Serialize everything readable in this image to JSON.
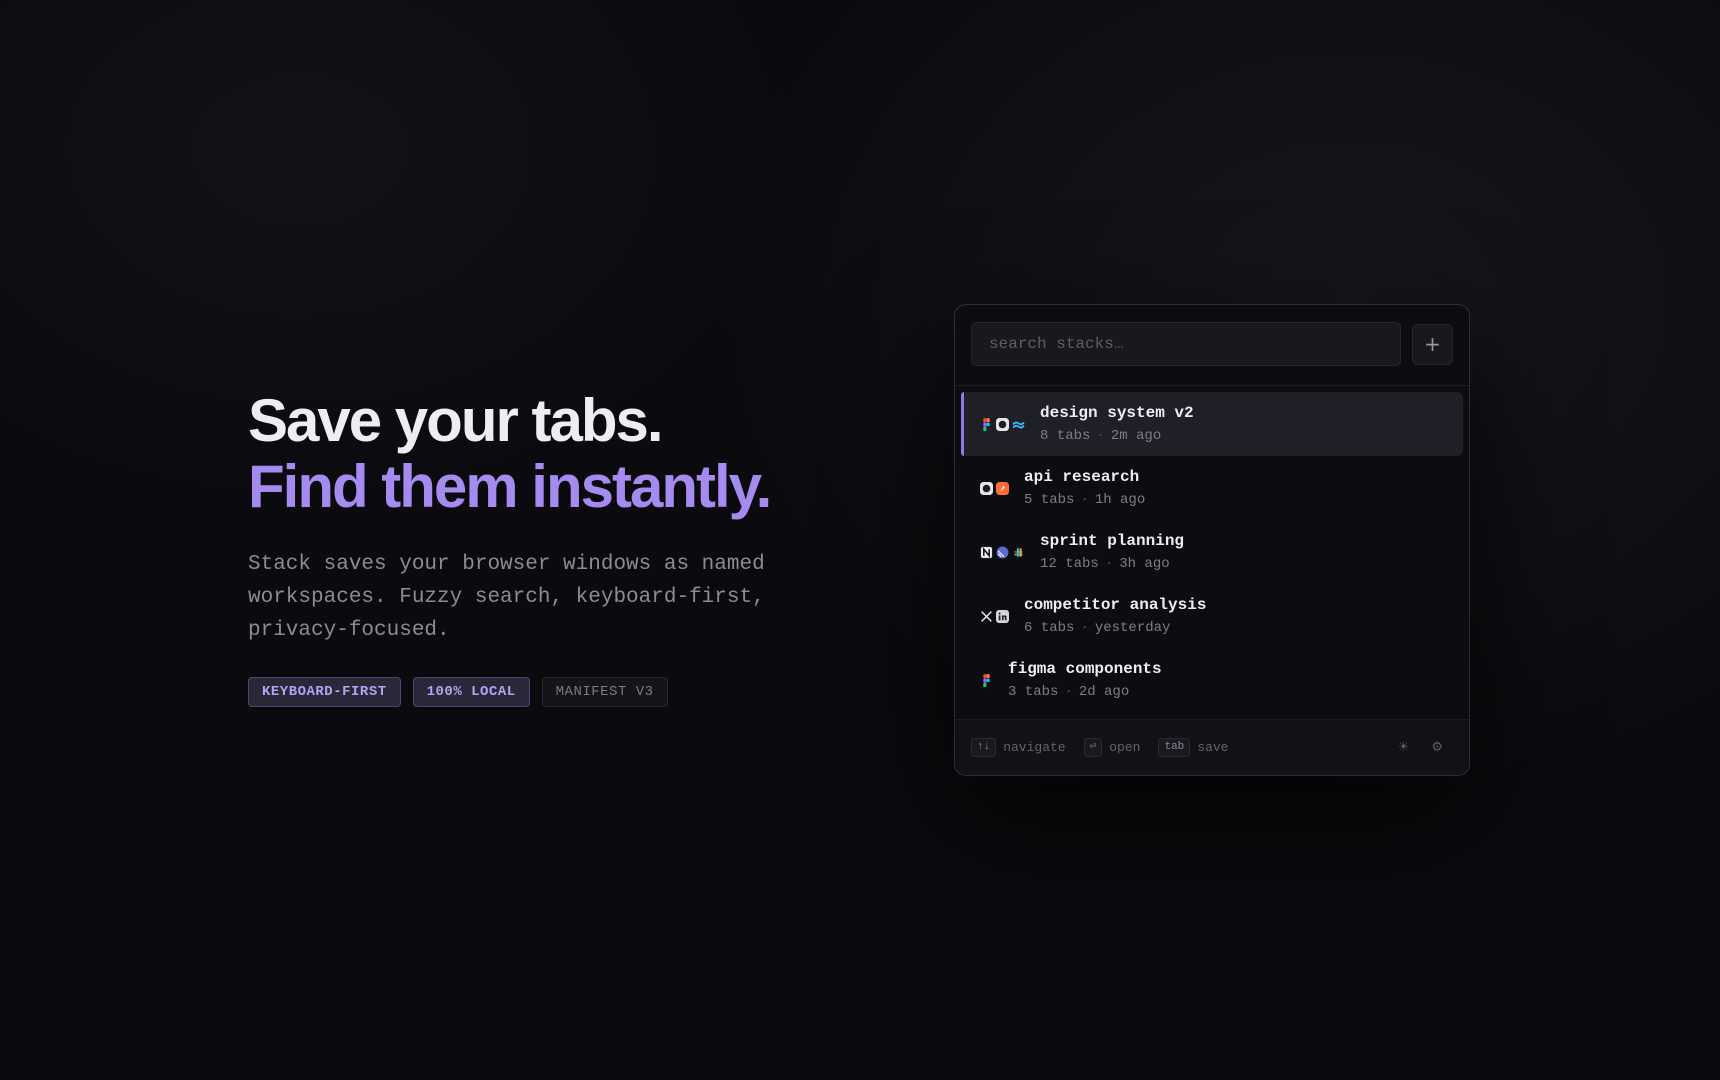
{
  "hero": {
    "headline_line1": "Save your tabs.",
    "headline_line2": "Find them instantly.",
    "description": "Stack saves your browser windows as named workspaces. Fuzzy search, keyboard-first, privacy-focused.",
    "badges": [
      "KEYBOARD-FIRST",
      "100% LOCAL",
      "MANIFEST V3"
    ]
  },
  "popup": {
    "search_placeholder": "search stacks…",
    "add_label": "+",
    "stacks": [
      {
        "title": "design system v2",
        "tabs": "8 tabs",
        "time": "2m ago",
        "selected": true,
        "favicons": [
          "figma-icon",
          "github-icon",
          "tailwind-icon"
        ]
      },
      {
        "title": "api research",
        "tabs": "5 tabs",
        "time": "1h ago",
        "selected": false,
        "favicons": [
          "github-icon",
          "postman-icon"
        ]
      },
      {
        "title": "sprint planning",
        "tabs": "12 tabs",
        "time": "3h ago",
        "selected": false,
        "favicons": [
          "notion-icon",
          "linear-icon",
          "slack-icon"
        ]
      },
      {
        "title": "competitor analysis",
        "tabs": "6 tabs",
        "time": "yesterday",
        "selected": false,
        "favicons": [
          "x-icon",
          "linkedin-icon"
        ]
      },
      {
        "title": "figma components",
        "tabs": "3 tabs",
        "time": "2d ago",
        "selected": false,
        "favicons": [
          "figma-icon"
        ]
      }
    ],
    "separator": "·",
    "footer": {
      "hints": [
        {
          "key": "↑↓",
          "label": "navigate"
        },
        {
          "key": "⏎",
          "label": "open"
        },
        {
          "key": "tab",
          "label": "save"
        }
      ],
      "theme_icon": "☀",
      "settings_icon": "⚙"
    }
  },
  "colors": {
    "accent": "#a58bf0",
    "background": "#0b0b0f",
    "panel": "#0d0d11"
  }
}
